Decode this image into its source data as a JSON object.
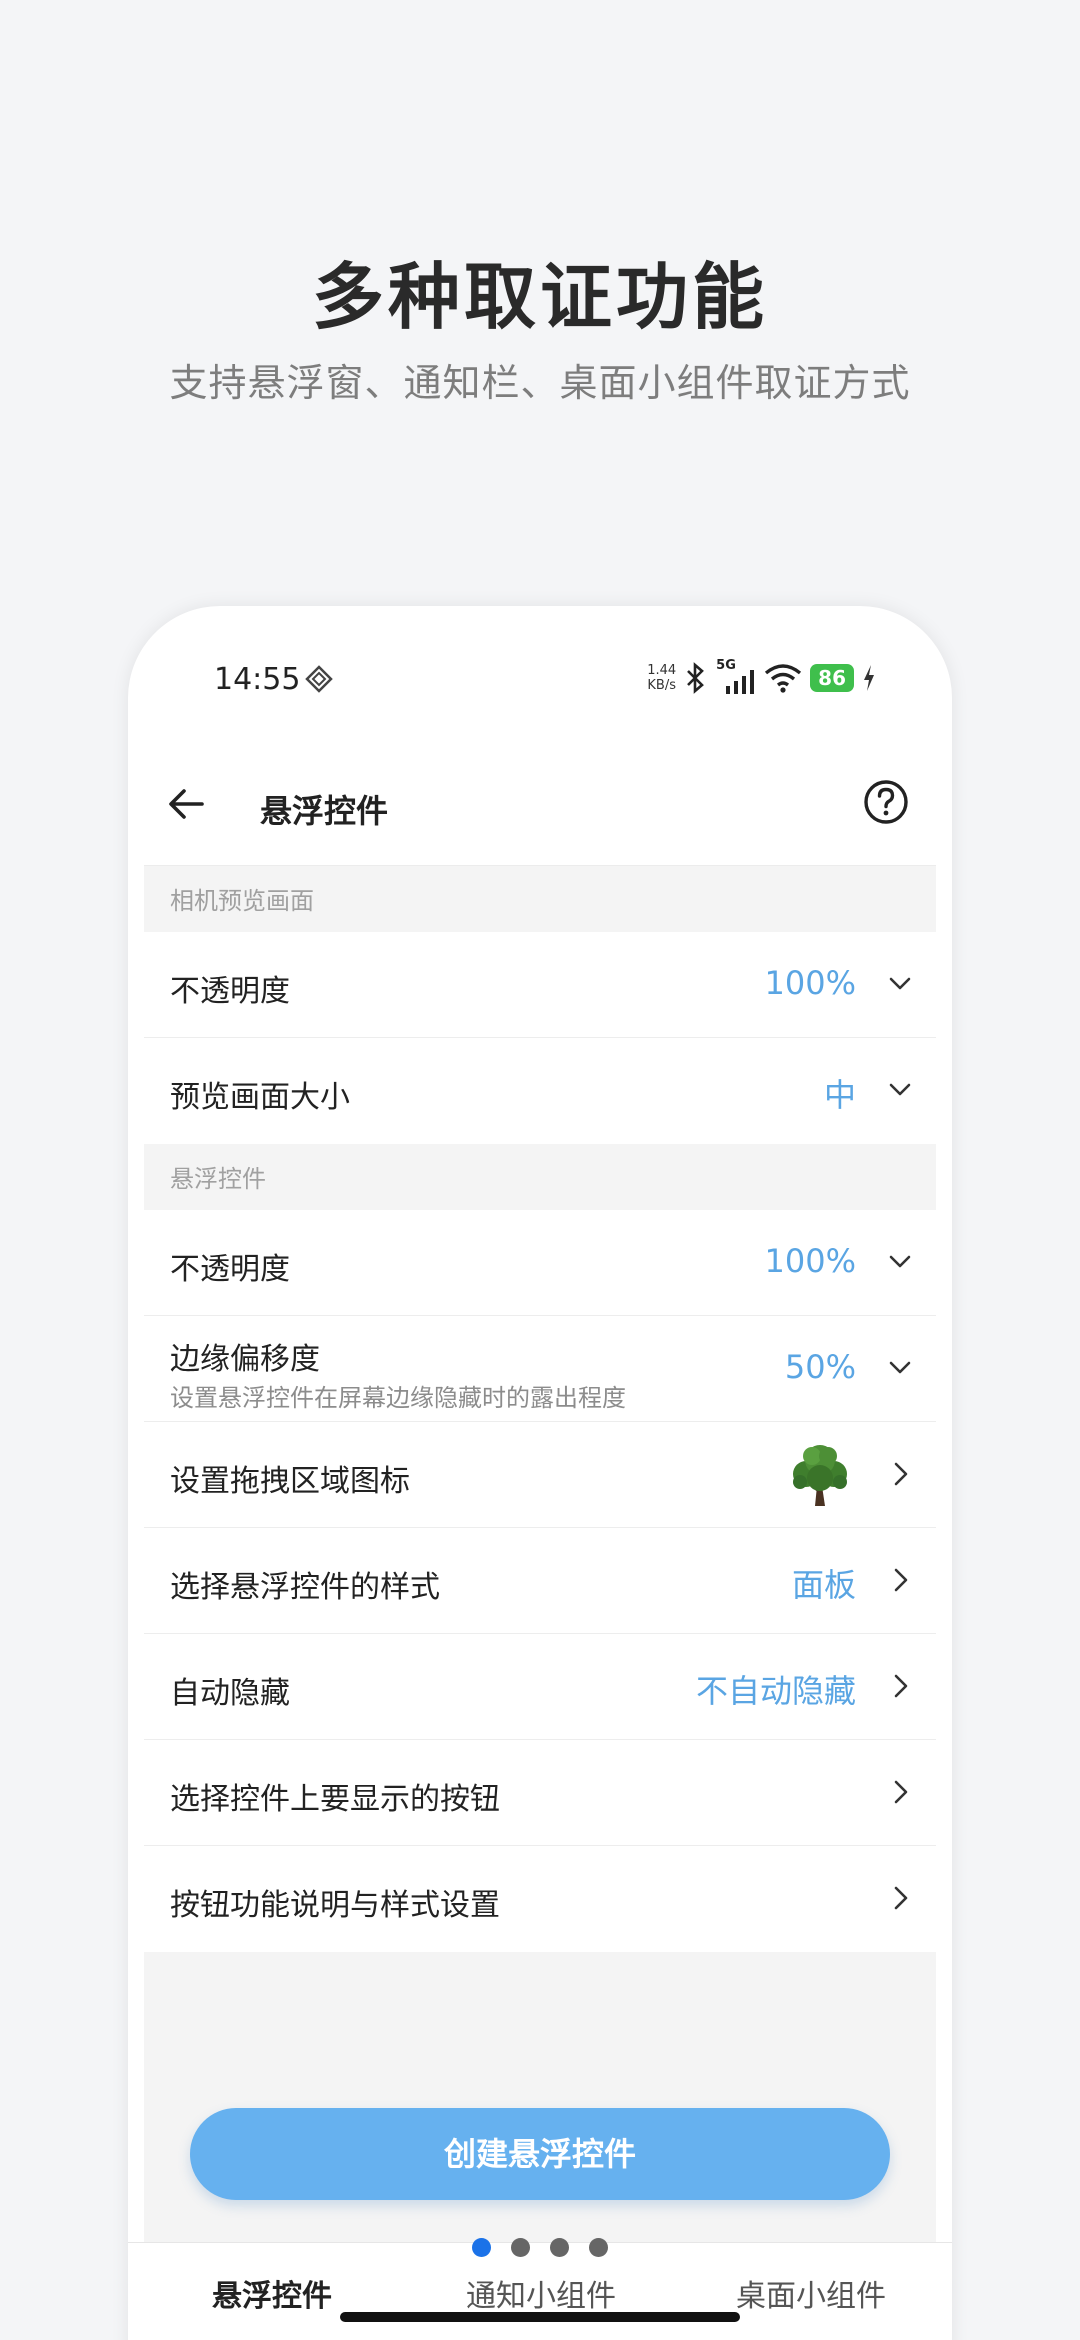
{
  "promo": {
    "title": "多种取证功能",
    "subtitle": "支持悬浮窗、通知栏、桌面小组件取证方式"
  },
  "status_bar": {
    "time": "14:55",
    "net_speed_value": "1.44",
    "net_speed_unit": "KB/s",
    "network": "5G",
    "battery": "86",
    "icons": [
      "diamond-icon",
      "bluetooth-icon",
      "signal-icon",
      "wifi-icon",
      "charging-icon"
    ]
  },
  "app_bar": {
    "title": "悬浮控件",
    "back_icon": "back-arrow-icon",
    "help_icon": "help-icon"
  },
  "sections": [
    {
      "header": "相机预览画面",
      "rows": [
        {
          "label": "不透明度",
          "value": "100%",
          "action": "dropdown"
        },
        {
          "label": "预览画面大小",
          "value": "中",
          "action": "dropdown"
        }
      ]
    },
    {
      "header": "悬浮控件",
      "rows": [
        {
          "label": "不透明度",
          "value": "100%",
          "action": "dropdown"
        },
        {
          "label": "边缘偏移度",
          "sub": "设置悬浮控件在屏幕边缘隐藏时的露出程度",
          "value": "50%",
          "action": "dropdown"
        },
        {
          "label": "设置拖拽区域图标",
          "icon": "tree-icon",
          "action": "navigate"
        },
        {
          "label": "选择悬浮控件的样式",
          "value": "面板",
          "action": "navigate"
        },
        {
          "label": "自动隐藏",
          "value": "不自动隐藏",
          "action": "navigate"
        },
        {
          "label": "选择控件上要显示的按钮",
          "action": "navigate"
        },
        {
          "label": "按钮功能说明与样式设置",
          "action": "navigate"
        }
      ]
    }
  ],
  "create_button": "创建悬浮控件",
  "tabs": [
    {
      "label": "悬浮控件",
      "active": true
    },
    {
      "label": "通知小组件",
      "active": false
    },
    {
      "label": "桌面小组件",
      "active": false
    }
  ],
  "pager": {
    "total": 4,
    "current": 1
  },
  "colors": {
    "accent": "#5aa5e3",
    "button": "#66b1ef",
    "battery": "#3fbf4c",
    "active_dot": "#1b72e8",
    "tree": "#3f7e2d"
  }
}
